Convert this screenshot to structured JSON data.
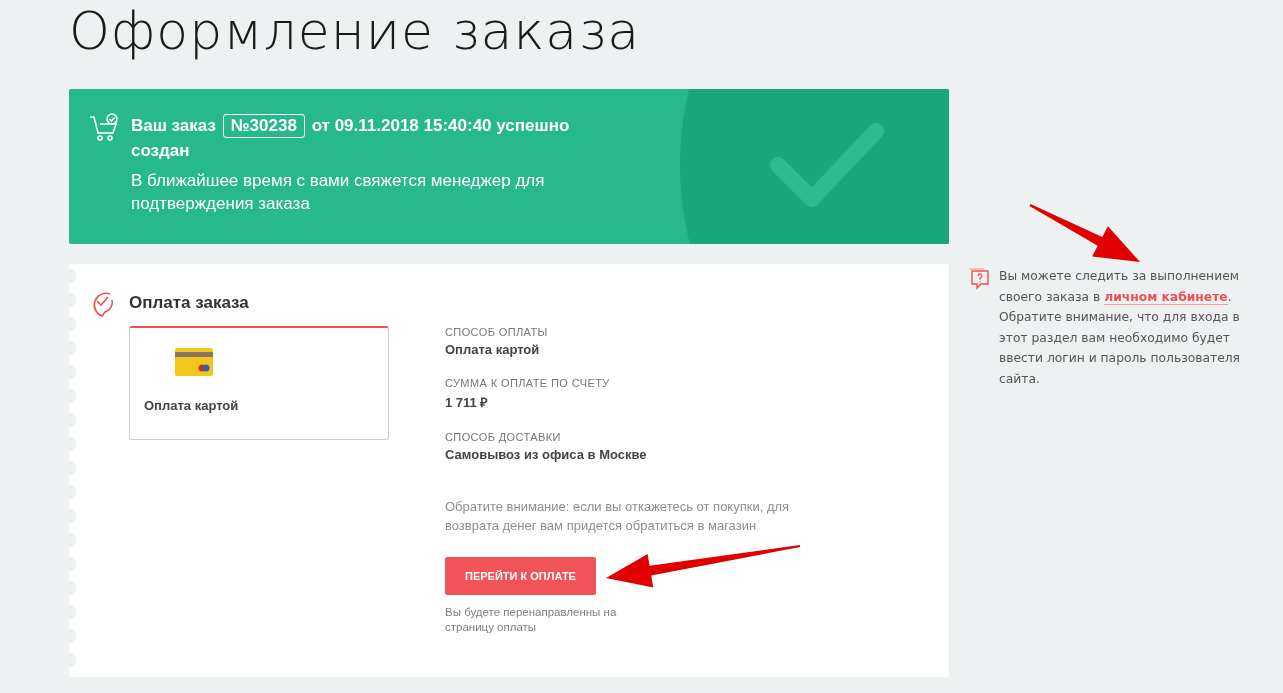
{
  "page": {
    "title": "Оформление заказа"
  },
  "success_banner": {
    "title_before": "Ваш заказ",
    "order_number": "№30238",
    "title_after": "от 09.11.2018 15:40:40 успешно создан",
    "message": "В ближайшее время с вами свяжется менеджер для подтверждения заказа"
  },
  "payment_section": {
    "title": "Оплата заказа",
    "methods": [
      {
        "label": "Оплата картой",
        "selected": true
      }
    ],
    "details": [
      {
        "label": "СПОСОБ ОПЛАТЫ",
        "value": "Оплата картой"
      },
      {
        "label": "СУММА К ОПЛАТЕ ПО СЧЕТУ",
        "value": "1 711 ₽"
      },
      {
        "label": "СПОСОБ ДОСТАВКИ",
        "value": "Самовывоз из офиса в Москве"
      }
    ],
    "notice": "Обратите внимание: если вы откажетесь от покупки, для возврата денег вам придется обратиться в магазин",
    "pay_button": "ПЕРЕЙТИ К ОПЛАТЕ",
    "redirect_note": "Вы будете перенаправленны на страницу оплаты"
  },
  "side_note": {
    "text_before": "Вы можете следить за выполнением своего заказа в ",
    "link": "личном кабинете",
    "text_after": ". Обратите внимание, что для входа в этот раздел вам необходимо будет ввести логин и пароль пользователя сайта."
  }
}
